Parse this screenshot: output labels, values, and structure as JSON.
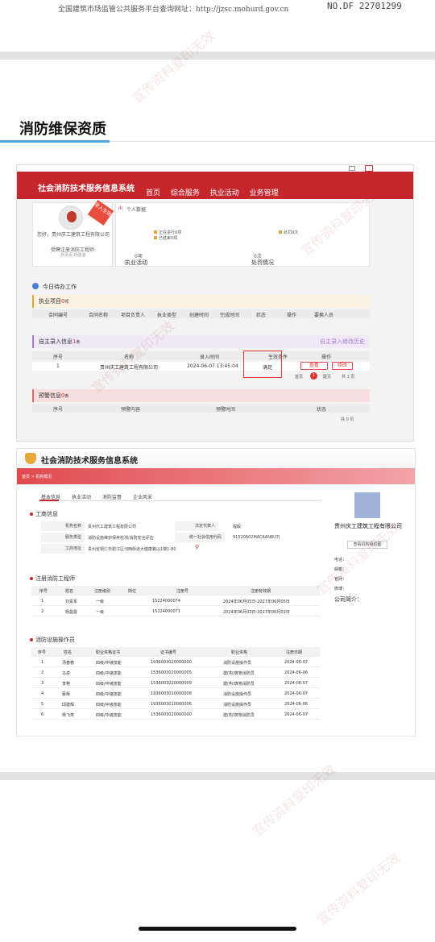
{
  "topline": {
    "text": "全国建筑市场监管公共服务平台查询网址：http://jzsc.mohurd.gov.cn",
    "code": "NO.DF  22701299"
  },
  "heading": "消防维保资质",
  "shot1": {
    "logo": "社会消防技术服务信息系统",
    "menu": [
      "首页",
      "综合服务",
      "执业活动",
      "业务管理"
    ],
    "ribbon": "录入生效",
    "greeting": "您好，贵州庆工建筑工程有限公司",
    "role": "受聘注册消防工程师:",
    "role_sub": "刘贵军,杨曼曼",
    "stats_title": "个人数据",
    "legend": [
      "正在进行0项",
      "已结束0项"
    ],
    "legend_right": "处罚0次",
    "zero_left": "0项",
    "zero_right": "0次",
    "exec_label": "执业活动",
    "penalty_label": "处罚情况",
    "todo": "今日待办工作",
    "exec_section": "执业项目",
    "exec_count": "0",
    "unit_item": "项",
    "exec_cols": [
      "合同编号",
      "合同名称",
      "项目负责人",
      "执业类型",
      "创建时间",
      "完成时间",
      "状态",
      "操作",
      "要换人员"
    ],
    "self_section": "自主录入信息",
    "self_count": "1",
    "unit_tiao": "条",
    "self_link": "自主录入修改历史",
    "self_cols": [
      "序号",
      "名称",
      "录入时间",
      "生效条件",
      "操作"
    ],
    "self_row": {
      "no": "1",
      "name": "贵州庆工建筑工程有限公司",
      "time": "2024-06-07 13:45:04",
      "cond": "满足",
      "view": "查看",
      "edit": "修改"
    },
    "pager": {
      "first": "首页",
      "current": "1",
      "last": "尾页",
      "total": "共 1 页"
    },
    "warn_section": "预警信息",
    "warn_count": "0",
    "warn_cols": [
      "序号",
      "预警内容",
      "预警时间",
      "状态"
    ],
    "warn_pager": "共 0 页"
  },
  "shot2": {
    "title": "社会消防技术服务信息系统",
    "breadcrumb": "首页 > 机构概况",
    "tabs": [
      "基本信息",
      "执业活动",
      "消防监督",
      "企业风采"
    ],
    "biz_title": "工商信息",
    "biz": {
      "name_label": "机构名称",
      "name": "贵州庆工建筑工程有限公司",
      "legal_label": "法定代表人",
      "legal": "程毅",
      "type_label": "服务类型",
      "type": "消防设施维护保养检测/消防安全评估",
      "credit_label": "统一社会信用代码",
      "credit": "91520602MAC6AN8U7J",
      "addr_label": "工商地址",
      "addr": "贵州省铜仁市碧江区河西街道大健康路以1楼1-80"
    },
    "eng_title": "注册消防工程师",
    "eng_cols": [
      "序号",
      "姓名",
      "注册级别",
      "岗位",
      "注册号",
      "注册有效期"
    ],
    "eng_rows": [
      {
        "no": "1",
        "name": "刘贵军",
        "level": "一级",
        "post": "",
        "reg": "15224000074",
        "valid": "2024年06月05日-2027年06月05日"
      },
      {
        "no": "2",
        "name": "杨曼曼",
        "level": "一级",
        "post": "",
        "reg": "15224000071",
        "valid": "2024年06月03日-2027年06月03日"
      }
    ],
    "op_title": "消防设施操作员",
    "op_cols": [
      "序号",
      "姓名",
      "职业资格证书",
      "证书编号",
      "职业资格",
      "注册日期"
    ],
    "op_rows": [
      {
        "no": "1",
        "name": "汤春春",
        "cert": "四级/中级技能",
        "num": "1936003020000000",
        "qual": "消防设施操作员",
        "date": "2024-06-07"
      },
      {
        "no": "2",
        "name": "马卓",
        "cert": "四级/中级技能",
        "num": "1536003020000005",
        "qual": "建(构)筑物消防员",
        "date": "2024-06-06"
      },
      {
        "no": "3",
        "name": "李艳",
        "cert": "四级/中级技能",
        "num": "1536003020000009",
        "qual": "建(构)筑物消防员",
        "date": "2024-06-07"
      },
      {
        "no": "4",
        "name": "蔡辉",
        "cert": "四级/中级技能",
        "num": "1936003010000008",
        "qual": "消防设施操作员",
        "date": "2024-06-07"
      },
      {
        "no": "5",
        "name": "邱建辉",
        "cert": "四级/中级技能",
        "num": "1936003010000006",
        "qual": "消防设施操作员",
        "date": "2024-06-06"
      },
      {
        "no": "6",
        "name": "杨飞燕",
        "cert": "四级/中级技能",
        "num": "1536003020000000",
        "qual": "建(构)筑物消防员",
        "date": "2024-06-07"
      }
    ],
    "org_name": "贵州庆工建筑工程有限公司",
    "org_btn": "查看机构组织图",
    "side": [
      "电话：",
      "邮箱：",
      "官网：",
      "微博："
    ],
    "intro": "公司简介："
  },
  "watermark": "宣传资料复印无效"
}
